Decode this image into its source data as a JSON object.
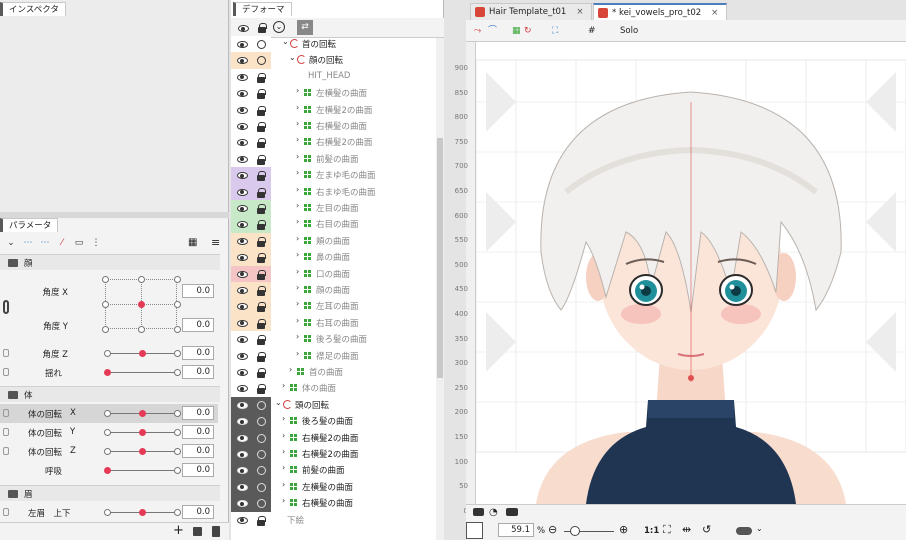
{
  "inspector": {
    "title": "インスペクタ"
  },
  "parameters": {
    "title": "パラメータ",
    "groups": [
      {
        "name": "顔"
      },
      {
        "name": "体"
      },
      {
        "name": "眉"
      }
    ],
    "rows": [
      {
        "label": "角度 X",
        "value": "0.0"
      },
      {
        "label": "角度 Y",
        "value": "0.0"
      },
      {
        "label": "角度 Z",
        "value": "0.0"
      },
      {
        "label": "揺れ",
        "value": "0.0"
      },
      {
        "label": "体の回転",
        "axis": "X",
        "value": "0.0"
      },
      {
        "label": "体の回転",
        "axis": "Y",
        "value": "0.0"
      },
      {
        "label": "体の回転",
        "axis": "Z",
        "value": "0.0"
      },
      {
        "label": "呼吸",
        "value": "0.0"
      },
      {
        "label": "左眉　上下",
        "value": "0.0"
      }
    ]
  },
  "deformer": {
    "title": "デフォーマ",
    "items": [
      {
        "name": "首の回転",
        "type": "rotation"
      },
      {
        "name": "顔の回転",
        "type": "rotation"
      },
      {
        "name": "HIT_HEAD",
        "type": "none"
      },
      {
        "name": "左横髪の曲面",
        "type": "warp"
      },
      {
        "name": "左横髪2の曲面",
        "type": "warp"
      },
      {
        "name": "右横髪の曲面",
        "type": "warp"
      },
      {
        "name": "右横髪2の曲面",
        "type": "warp"
      },
      {
        "name": "前髪の曲面",
        "type": "warp"
      },
      {
        "name": "左まゆ毛の曲面",
        "type": "warp"
      },
      {
        "name": "右まゆ毛の曲面",
        "type": "warp"
      },
      {
        "name": "左目の曲面",
        "type": "warp"
      },
      {
        "name": "右目の曲面",
        "type": "warp"
      },
      {
        "name": "頬の曲面",
        "type": "warp"
      },
      {
        "name": "鼻の曲面",
        "type": "warp"
      },
      {
        "name": "口の曲面",
        "type": "warp"
      },
      {
        "name": "顔の曲面",
        "type": "warp"
      },
      {
        "name": "左耳の曲面",
        "type": "warp"
      },
      {
        "name": "右耳の曲面",
        "type": "warp"
      },
      {
        "name": "後ろ髪の曲面",
        "type": "warp"
      },
      {
        "name": "襟足の曲面",
        "type": "warp"
      },
      {
        "name": "首の曲面",
        "type": "warp"
      },
      {
        "name": "体の曲面",
        "type": "warp"
      },
      {
        "name": "頭の回転",
        "type": "rotation"
      },
      {
        "name": "後ろ髪の曲面",
        "type": "warp"
      },
      {
        "name": "右横髪2の曲面",
        "type": "warp"
      },
      {
        "name": "右横髪2の曲面",
        "type": "warp"
      },
      {
        "name": "前髪の曲面",
        "type": "warp"
      },
      {
        "name": "左横髪の曲面",
        "type": "warp"
      },
      {
        "name": "右横髪の曲面",
        "type": "warp"
      },
      {
        "name": "下絵",
        "type": "none"
      }
    ]
  },
  "documents": {
    "tabs": [
      {
        "label": "Hair Template_t01",
        "close": "×"
      },
      {
        "label": "* kei_vowels_pro_t02",
        "close": "×"
      }
    ]
  },
  "canvas_toolbar": {
    "solo_label": "Solo"
  },
  "ruler": {
    "ticks": [
      "900",
      "850",
      "800",
      "750",
      "700",
      "650",
      "600",
      "550",
      "500",
      "450",
      "400",
      "350",
      "300",
      "250",
      "200",
      "150",
      "100",
      "50",
      "0"
    ]
  },
  "status": {
    "zoom": "59.1",
    "zoom_unit": "%",
    "ratio_label": "1:1"
  }
}
